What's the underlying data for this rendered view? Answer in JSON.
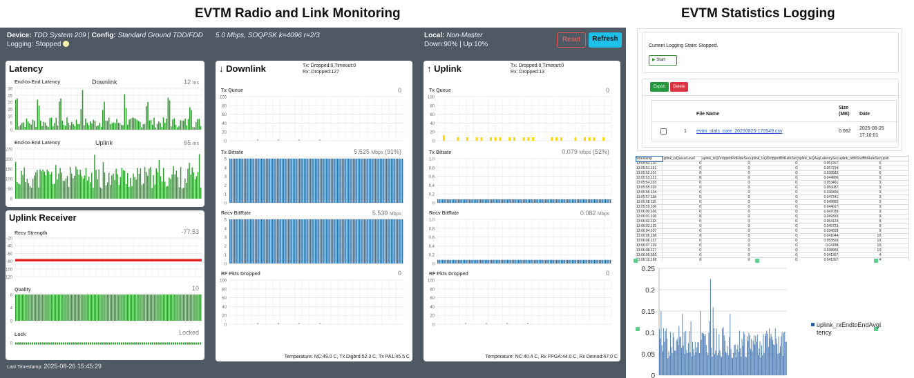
{
  "headings": {
    "left": "EVTM Radio and Link Monitoring",
    "right": "EVTM Statistics Logging"
  },
  "header": {
    "device_label": "Device:",
    "device": "TDD System 209",
    "config_label": "Config:",
    "config": "Standard Ground TDD/FDD",
    "logging": "Logging: Stopped",
    "mode": "5.0 Mbps, SOQPSK k=4096 r=2/3",
    "local_label": "Local:",
    "local": "Non-Master",
    "downup": "Down:90% | Up:10%",
    "reset": "Reset",
    "refresh": "Refresh"
  },
  "latency": {
    "title": "Latency",
    "e2e1": "End-to-End Latency",
    "sub1": "Downlink",
    "val1": "12",
    "unit1": "ms",
    "e2e2": "End-to-End Latency",
    "sub2": "Uplink",
    "val2": "65",
    "unit2": "ms",
    "ticks1": [
      "30",
      "25",
      "20",
      "15",
      "10",
      "5",
      "0"
    ],
    "ticks2": [
      "270",
      "200",
      "150",
      "100",
      "50",
      "0"
    ]
  },
  "receiver": {
    "title": "Uplink Receiver",
    "recv": "Recv Strength",
    "recv_val": "-77.53",
    "recv_ticks": [
      "-20",
      "-40",
      "-60",
      "-80",
      "-100",
      "-120"
    ],
    "quality": "Quality",
    "quality_val": "10",
    "quality_ticks": [
      "8",
      "4",
      "0"
    ],
    "lock": "Lock",
    "lock_val": "Locked",
    "lock_ticks": [
      "0"
    ]
  },
  "downlink": {
    "title": "Downlink",
    "drops1": "Tx: Dropped:0,Timeout:0",
    "drops2": "Rx: Dropped:127",
    "txq": "Tx Queue",
    "txq_val": "0",
    "txb": "Tx Bitrate",
    "txb_val": "5.525",
    "txb_unit": "Mbps",
    "txb_pct": "(91%)",
    "rxb": "Recv BitRate",
    "rxb_val": "5.539",
    "rxb_unit": "Mbps",
    "rf": "RF Pkts Dropped",
    "rf_val": "0",
    "ticks_q": [
      "100",
      "80",
      "60",
      "40",
      "20",
      "0"
    ],
    "ticks_b": [
      "5",
      "4",
      "3",
      "2",
      "1",
      "0"
    ],
    "temp": "Temperature: NC:49.0 C, Tx Digbrd:52.3 C, Tx PA1:45.5 C"
  },
  "uplink": {
    "title": "Uplink",
    "drops1": "Tx: Dropped:0,Timeout:0",
    "drops2": "Rx: Dropped:13",
    "txq": "Tx Queue",
    "txq_val": "0",
    "txb": "Tx Bitrate",
    "txb_val": "0.079",
    "txb_unit": "Mbps",
    "txb_pct": "(52%)",
    "rxb": "Recv BitRate",
    "rxb_val": "0.082",
    "rxb_unit": "Mbps",
    "rf": "RF Pkts Dropped",
    "rf_val": "0",
    "ticks_q": [
      "100",
      "80",
      "60",
      "40",
      "20",
      "0"
    ],
    "ticks_b": [
      "1.0",
      "0.8",
      "0.6",
      "0.4",
      "0.2",
      "0"
    ],
    "temp": "Temperature: NC:40.4 C, Rx FPGA:44.0 C, Rx Demod:47.0 C"
  },
  "footer": {
    "ts_label": "Last Timestamp:",
    "ts": "2025-08-26 15:45:29"
  },
  "logging": {
    "state": "Current Logging State: Stopped.",
    "start": "Start",
    "export": "Export",
    "delete": "Delete",
    "cols": {
      "file": "File Name",
      "size": "Size (MB)",
      "date": "Date"
    },
    "row": {
      "idx": "1",
      "file": "evtm_stats_core_20250825-170549.csv",
      "size": "0.062",
      "date1": "2025-08-25",
      "date2": "17:10:01"
    }
  },
  "sheet": {
    "headers": [
      "timestamp",
      "uplink_txQueueLevel",
      "uplink_txQDroppedPktRateSec",
      "uplink_txQDroppedBitRateSec",
      "uplink_txQAvgLatencySec",
      "uplink_txBitStuffBitRateSec",
      "uplin"
    ],
    "rows": [
      [
        "13:05:50.130",
        "0",
        "0",
        "0",
        "0.057267",
        "6"
      ],
      [
        "13:05:51.151",
        "0",
        "0",
        "0",
        "0.057234",
        "6"
      ],
      [
        "13:05:52.101",
        "8",
        "0",
        "0",
        "0.038583",
        "6"
      ],
      [
        "13:05:53.121",
        "8",
        "0",
        "0",
        "0.044806",
        "3"
      ],
      [
        "13:05:54.103",
        "0",
        "0",
        "0",
        "0.053461",
        "3"
      ],
      [
        "13:05:55.103",
        "0",
        "0",
        "0",
        "0.050087",
        "3"
      ],
      [
        "13:05:56.104",
        "0",
        "0",
        "0",
        "0.038466",
        "3"
      ],
      [
        "13:05:57.138",
        "0",
        "0",
        "0",
        "0.047241",
        "3"
      ],
      [
        "13:05:58.115",
        "0",
        "0",
        "0",
        "0.049882",
        "3"
      ],
      [
        "13:05:59.106",
        "0",
        "0",
        "0",
        "0.044017",
        "3"
      ],
      [
        "13:06:00.106",
        "0",
        "0",
        "0",
        "0.047039",
        "3"
      ],
      [
        "13:06:01.106",
        "8",
        "0",
        "0",
        "0.049333",
        "9"
      ],
      [
        "13:06:02.113",
        "0",
        "0",
        "0",
        "0.054124",
        "9"
      ],
      [
        "13:06:03.125",
        "0",
        "0",
        "0",
        "0.045723",
        "9"
      ],
      [
        "13:06:04.107",
        "0",
        "0",
        "0",
        "0.034028",
        "9"
      ],
      [
        "13:06:05.108",
        "8",
        "0",
        "0",
        "0.041044",
        "10"
      ],
      [
        "13:06:06.127",
        "0",
        "0",
        "0",
        "0.053593",
        "10"
      ],
      [
        "13:06:07.109",
        "0",
        "0",
        "0",
        "0.04788",
        "10"
      ],
      [
        "13:06:08.127",
        "0",
        "0",
        "0",
        "0.038966",
        "10"
      ],
      [
        "13:06:09.559",
        "0",
        "0",
        "0",
        "0.041367",
        "4"
      ],
      [
        "13:06:10.168",
        "8",
        "0",
        "0",
        "0.041367",
        "4"
      ]
    ]
  },
  "excel_chart": {
    "legend": "uplink_rxEndtoEndAvgLatency",
    "legend1": "uplink_rxEndtoEndAvgLa",
    "legend2": "tency",
    "yticks": [
      "0.25",
      "0.2",
      "0.15",
      "0.1",
      "0.05",
      "0"
    ]
  },
  "colors": {
    "bg": "#4f5964",
    "green": "#2e9e2e",
    "blue": "#1f77b4",
    "red": "#e82020",
    "cyan": "#00bcd4",
    "yellow": "#ffd800"
  }
}
